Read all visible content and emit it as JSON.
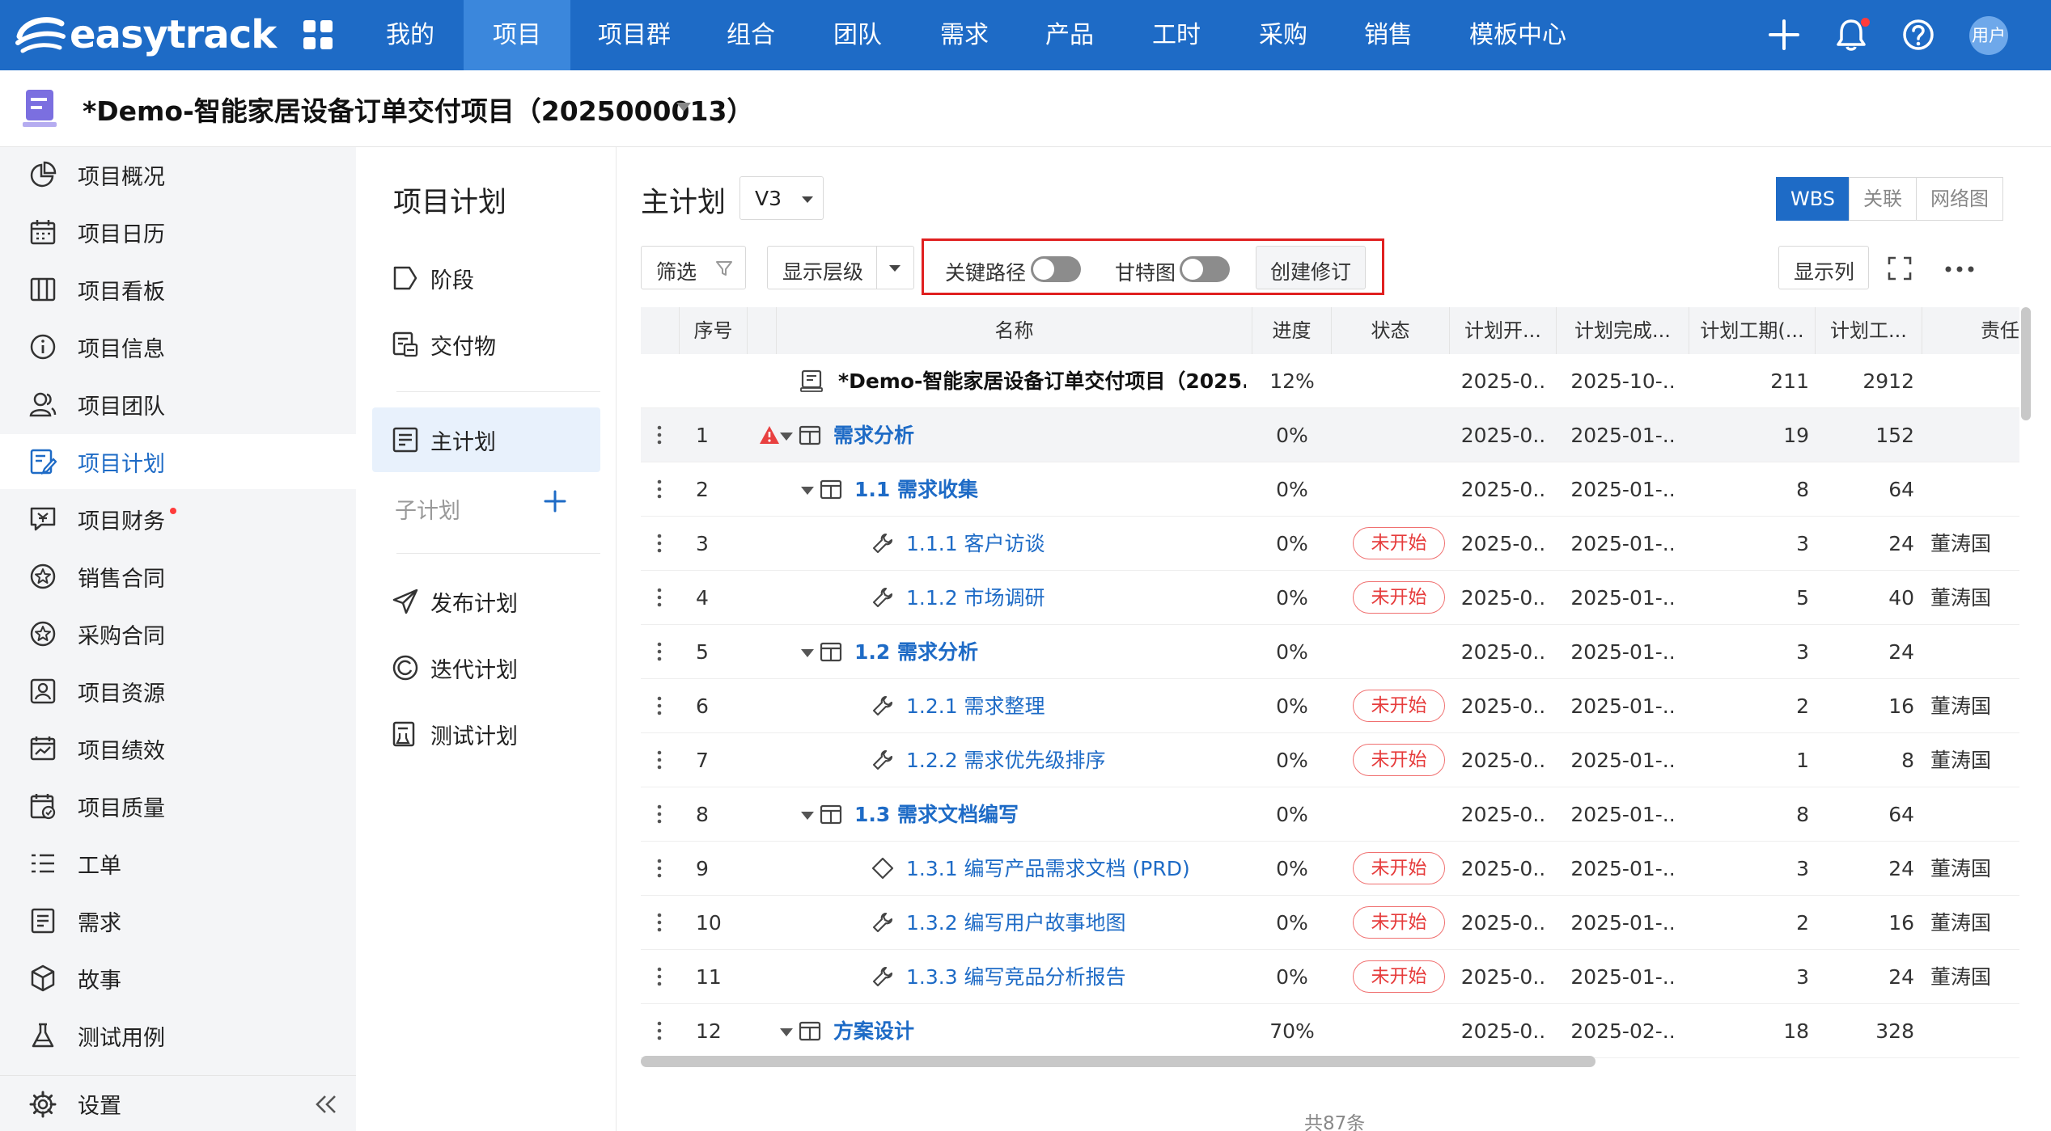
{
  "topbar": {
    "brand": "easytrack",
    "nav": [
      "我的",
      "项目",
      "项目群",
      "组合",
      "团队",
      "需求",
      "产品",
      "工时",
      "采购",
      "销售",
      "模板中心"
    ],
    "active_nav": "项目",
    "avatar": "用户",
    "color": "#1e6bc6"
  },
  "project": {
    "title": "*Demo-智能家居设备订单交付项目（2025000013）"
  },
  "sidebar": {
    "items": [
      "项目概况",
      "项目日历",
      "项目看板",
      "项目信息",
      "项目团队",
      "项目计划",
      "项目财务",
      "销售合同",
      "采购合同",
      "项目资源",
      "项目绩效",
      "项目质量",
      "工单",
      "需求",
      "故事",
      "测试用例"
    ],
    "active": "项目计划",
    "settings": "设置"
  },
  "panel2": {
    "title": "项目计划",
    "items": [
      "阶段",
      "交付物",
      "主计划"
    ],
    "active": "主计划",
    "subplan": "子计划",
    "extra": [
      "发布计划",
      "迭代计划",
      "测试计划"
    ]
  },
  "main": {
    "title": "主计划",
    "version": "V3",
    "view_tabs": [
      "WBS",
      "关联",
      "网络图"
    ],
    "active_tab": "WBS",
    "filter": "筛选",
    "display_level": "显示层级",
    "critical_path": "关键路径",
    "gantt": "甘特图",
    "create_revision": "创建修订",
    "show_columns": "显示列",
    "total": "共87条"
  },
  "table": {
    "columns": [
      "序号",
      "名称",
      "进度",
      "状态",
      "计划开...",
      "计划完成...",
      "计划工期(...",
      "计划工...",
      "责任"
    ],
    "root": {
      "name": "*Demo-智能家居设备订单交付项目（2025...",
      "progress": "12%",
      "start": "2025-0..",
      "end": "2025-10-..",
      "duration": "211",
      "work": "2912"
    },
    "rows": [
      {
        "seq": "1",
        "name": "需求分析",
        "level": 0,
        "type": "group",
        "warn": true,
        "progress": "0%",
        "status": "",
        "start": "2025-0..",
        "end": "2025-01-..",
        "duration": "19",
        "work": "152",
        "owner": ""
      },
      {
        "seq": "2",
        "name": "1.1 需求收集",
        "level": 1,
        "type": "group",
        "warn": false,
        "progress": "0%",
        "status": "",
        "start": "2025-0..",
        "end": "2025-01-..",
        "duration": "8",
        "work": "64",
        "owner": ""
      },
      {
        "seq": "3",
        "name": "1.1.1 客户访谈",
        "level": 2,
        "type": "task",
        "warn": false,
        "progress": "0%",
        "status": "未开始",
        "start": "2025-0..",
        "end": "2025-01-..",
        "duration": "3",
        "work": "24",
        "owner": "董涛国"
      },
      {
        "seq": "4",
        "name": "1.1.2 市场调研",
        "level": 2,
        "type": "task",
        "warn": false,
        "progress": "0%",
        "status": "未开始",
        "start": "2025-0..",
        "end": "2025-01-..",
        "duration": "5",
        "work": "40",
        "owner": "董涛国"
      },
      {
        "seq": "5",
        "name": "1.2 需求分析",
        "level": 1,
        "type": "group",
        "warn": false,
        "progress": "0%",
        "status": "",
        "start": "2025-0..",
        "end": "2025-01-..",
        "duration": "3",
        "work": "24",
        "owner": ""
      },
      {
        "seq": "6",
        "name": "1.2.1 需求整理",
        "level": 2,
        "type": "task",
        "warn": false,
        "progress": "0%",
        "status": "未开始",
        "start": "2025-0..",
        "end": "2025-01-..",
        "duration": "2",
        "work": "16",
        "owner": "董涛国"
      },
      {
        "seq": "7",
        "name": "1.2.2 需求优先级排序",
        "level": 2,
        "type": "task",
        "warn": false,
        "progress": "0%",
        "status": "未开始",
        "start": "2025-0..",
        "end": "2025-01-..",
        "duration": "1",
        "work": "8",
        "owner": "董涛国"
      },
      {
        "seq": "8",
        "name": "1.3 需求文档编写",
        "level": 1,
        "type": "group",
        "warn": false,
        "progress": "0%",
        "status": "",
        "start": "2025-0..",
        "end": "2025-01-..",
        "duration": "8",
        "work": "64",
        "owner": ""
      },
      {
        "seq": "9",
        "name": "1.3.1 编写产品需求文档 (PRD)",
        "level": 2,
        "type": "milestone",
        "warn": false,
        "progress": "0%",
        "status": "未开始",
        "start": "2025-0..",
        "end": "2025-01-..",
        "duration": "3",
        "work": "24",
        "owner": "董涛国"
      },
      {
        "seq": "10",
        "name": "1.3.2 编写用户故事地图",
        "level": 2,
        "type": "task",
        "warn": false,
        "progress": "0%",
        "status": "未开始",
        "start": "2025-0..",
        "end": "2025-01-..",
        "duration": "2",
        "work": "16",
        "owner": "董涛国"
      },
      {
        "seq": "11",
        "name": "1.3.3 编写竞品分析报告",
        "level": 2,
        "type": "task",
        "warn": false,
        "progress": "0%",
        "status": "未开始",
        "start": "2025-0..",
        "end": "2025-01-..",
        "duration": "3",
        "work": "24",
        "owner": "董涛国"
      },
      {
        "seq": "12",
        "name": "方案设计",
        "level": 0,
        "type": "group",
        "warn": false,
        "progress": "70%",
        "status": "",
        "start": "2025-0..",
        "end": "2025-02-..",
        "duration": "18",
        "work": "328",
        "owner": ""
      }
    ]
  }
}
